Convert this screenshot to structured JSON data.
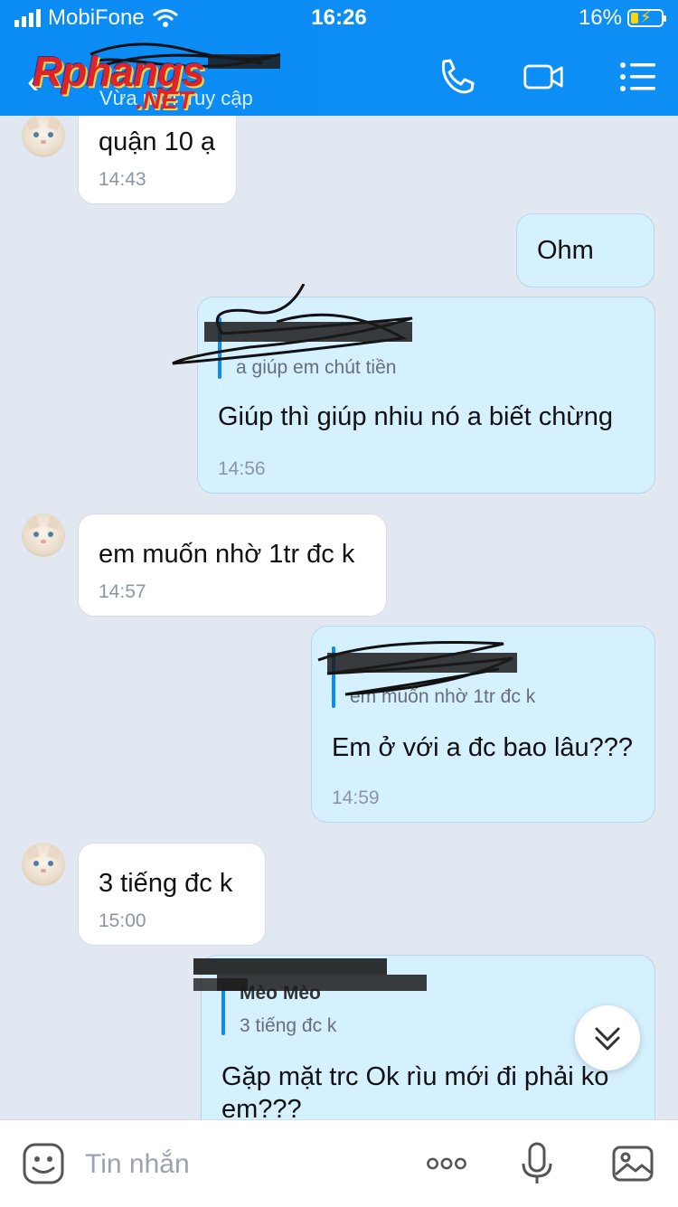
{
  "status_bar": {
    "carrier": "MobiFone",
    "time": "16:26",
    "battery": "16%"
  },
  "header": {
    "watermark": "Rphangs",
    "watermark_sub": ".NET",
    "subtitle": "Vừa mới truy cập",
    "icons": [
      "back-icon",
      "phone-icon",
      "video-call-icon",
      "menu-icon"
    ]
  },
  "messages": [
    {
      "side": "in",
      "text": "quận 10 ạ",
      "time": "14:43"
    },
    {
      "side": "out",
      "text": "Ohm"
    },
    {
      "side": "out",
      "quote_text": "a giúp em chút tiền",
      "text": "Giúp thì giúp nhiu nó a biết chừng",
      "time": "14:56"
    },
    {
      "side": "in",
      "text": "em muốn nhờ 1tr đc k",
      "time": "14:57"
    },
    {
      "side": "out",
      "quote_text": "em muốn nhờ 1tr đc k",
      "text": "Em ở với a đc bao lâu???",
      "time": "14:59"
    },
    {
      "side": "in",
      "text": "3 tiếng đc k",
      "time": "15:00"
    },
    {
      "side": "out",
      "quote_author": "Mèo Mèo",
      "quote_text": "3 tiếng đc k",
      "text_line1": "Gặp mặt trc Ok rìu mới đi phải ko",
      "text_line2": "em???"
    }
  ],
  "composer": {
    "placeholder": "Tin nhắn",
    "icons": [
      "sticker-icon",
      "more-icon",
      "microphone-icon",
      "image-icon"
    ]
  },
  "colors": {
    "header_blue": "#0b8cf5",
    "outgoing_bubble": "#d5f0ff",
    "incoming_bubble": "#ffffff",
    "background": "#e2e8f1"
  }
}
